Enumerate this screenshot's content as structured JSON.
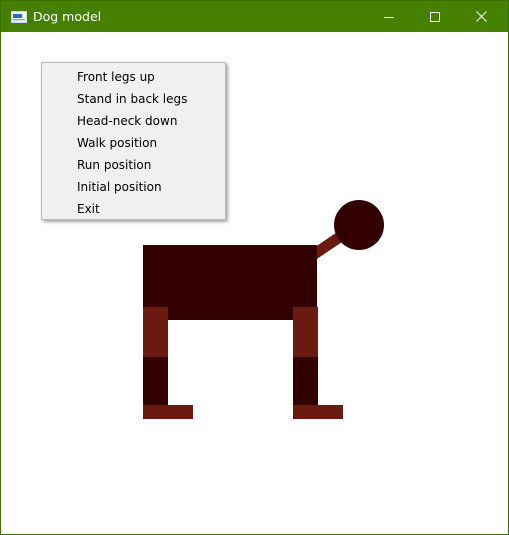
{
  "window": {
    "title": "Dog model",
    "title_bar_color": "#468000",
    "icons": {
      "app": "app-icon",
      "minimize": "minimize-icon",
      "maximize": "maximize-icon",
      "close": "close-icon"
    }
  },
  "context_menu": {
    "items": [
      {
        "label": "Front legs up"
      },
      {
        "label": "Stand in back legs"
      },
      {
        "label": "Head-neck down"
      },
      {
        "label": "Walk position"
      },
      {
        "label": "Run position"
      },
      {
        "label": "Initial position"
      },
      {
        "label": "Exit"
      }
    ]
  },
  "dog_model": {
    "colors": {
      "body": "#330000",
      "limb": "#6b1a10",
      "head": "#330000"
    }
  }
}
